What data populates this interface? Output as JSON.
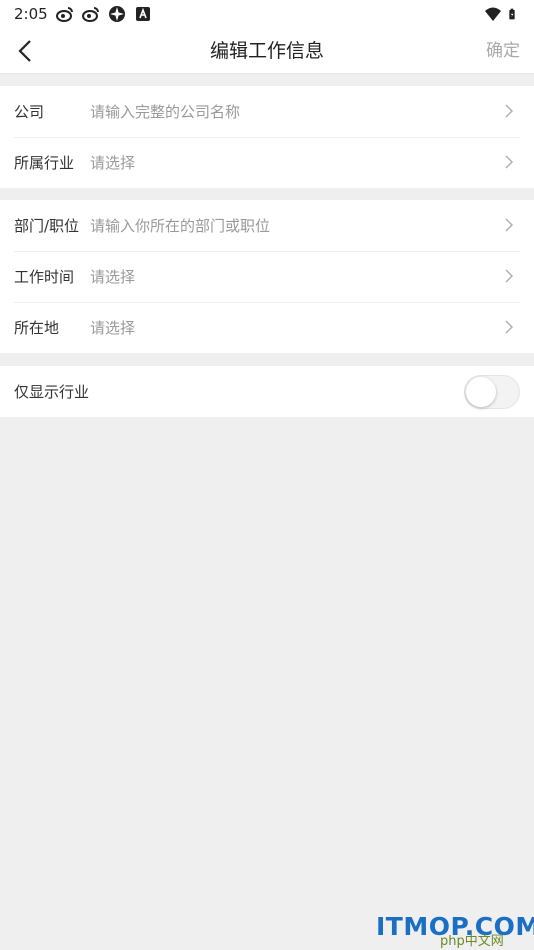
{
  "status_bar": {
    "time": "2:05",
    "icons": [
      "weibo-icon",
      "weibo-icon",
      "pinwheel-icon",
      "a-icon"
    ],
    "right_icons": [
      "wifi-icon",
      "battery-icon"
    ]
  },
  "nav": {
    "title": "编辑工作信息",
    "confirm_label": "确定"
  },
  "form": {
    "company": {
      "label": "公司",
      "placeholder": "请输入完整的公司名称"
    },
    "industry": {
      "label": "所属行业",
      "placeholder": "请选择"
    },
    "department": {
      "label": "部门/职位",
      "placeholder": "请输入你所在的部门或职位"
    },
    "work_time": {
      "label": "工作时间",
      "placeholder": "请选择"
    },
    "location": {
      "label": "所在地",
      "placeholder": "请选择"
    },
    "only_show_industry": {
      "label": "仅显示行业",
      "enabled": false
    }
  },
  "watermark": {
    "text": "ITMOP.COM",
    "sub": "php中文网"
  },
  "colors": {
    "accent_disabled": "#aaaaaa",
    "background": "#efefef"
  }
}
